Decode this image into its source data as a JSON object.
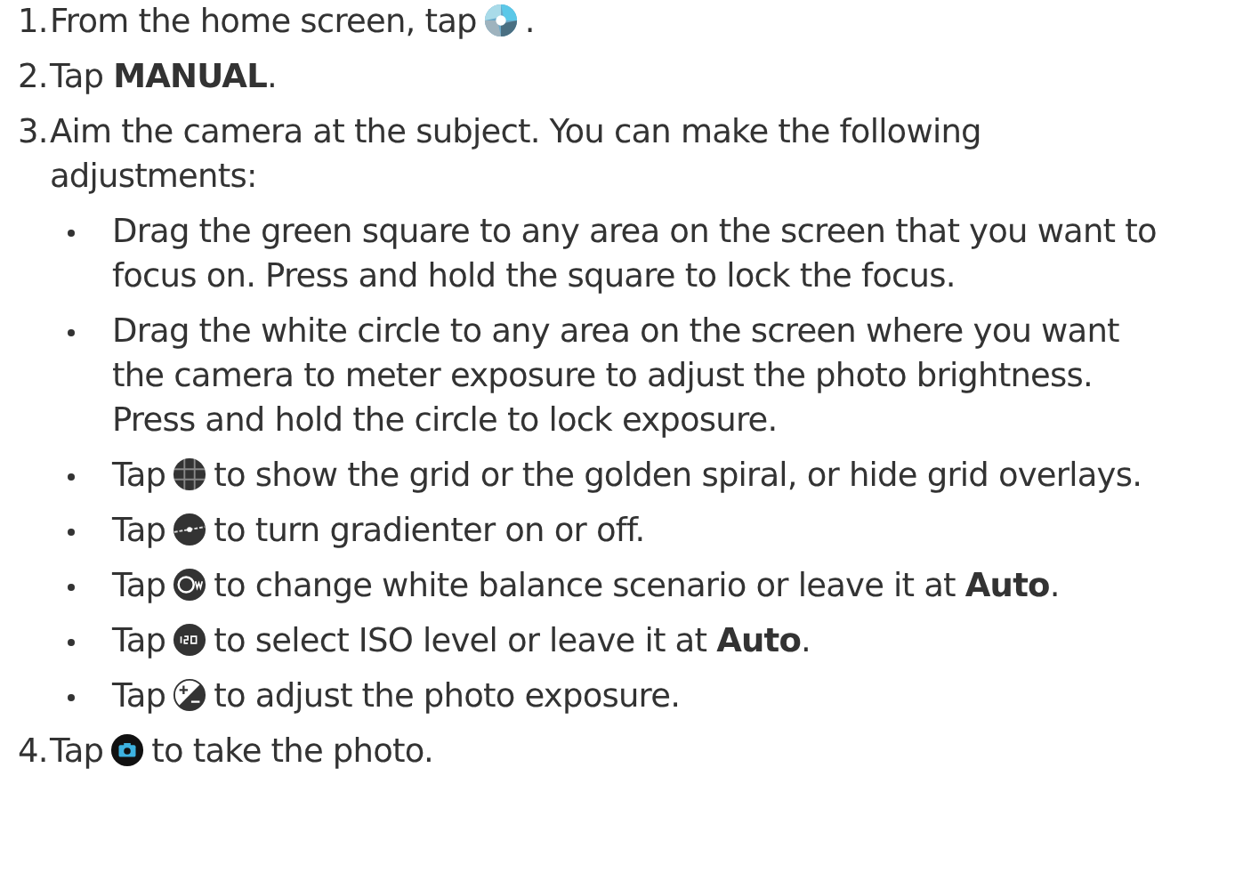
{
  "steps": [
    {
      "number": "1.",
      "parts": [
        {
          "kind": "text",
          "text": "From the home screen, tap"
        },
        {
          "kind": "app-icon"
        },
        {
          "kind": "text",
          "text": "."
        }
      ]
    },
    {
      "number": "2.",
      "parts": [
        {
          "kind": "text",
          "text": "Tap **MANUAL**."
        }
      ]
    },
    {
      "number": "3.",
      "parts": [
        {
          "kind": "text",
          "text": "Aim the camera at the subject. You can make the following adjustments:"
        }
      ],
      "bullets": [
        {
          "parts": [
            {
              "kind": "text",
              "text": "Drag the green square to any area on the screen that you want to focus on. Press and hold the square to lock the focus."
            }
          ]
        },
        {
          "parts": [
            {
              "kind": "text",
              "text": "Drag the white circle to any area on the screen where you want the camera to meter exposure to adjust the photo brightness. Press and hold the circle to lock exposure."
            }
          ]
        },
        {
          "parts": [
            {
              "kind": "text",
              "text": "Tap"
            },
            {
              "kind": "grid-icon"
            },
            {
              "kind": "text",
              "text": "to show the grid or the golden spiral, or hide grid overlays."
            }
          ]
        },
        {
          "parts": [
            {
              "kind": "text",
              "text": "Tap"
            },
            {
              "kind": "level-icon"
            },
            {
              "kind": "text",
              "text": "to turn gradienter on or off."
            }
          ]
        },
        {
          "parts": [
            {
              "kind": "text",
              "text": "Tap"
            },
            {
              "kind": "wb-icon"
            },
            {
              "kind": "text",
              "text": "to change white balance scenario or leave it at **Auto**."
            }
          ]
        },
        {
          "parts": [
            {
              "kind": "text",
              "text": "Tap"
            },
            {
              "kind": "iso-icon"
            },
            {
              "kind": "text",
              "text": "to select ISO level or leave it at **Auto**."
            }
          ]
        },
        {
          "parts": [
            {
              "kind": "text",
              "text": "Tap"
            },
            {
              "kind": "exposure-icon"
            },
            {
              "kind": "text",
              "text": "to adjust the photo exposure."
            }
          ]
        }
      ]
    },
    {
      "number": "4.",
      "parts": [
        {
          "kind": "text",
          "text": "Tap"
        },
        {
          "kind": "shutter-icon"
        },
        {
          "kind": "text",
          "text": "to take the photo."
        }
      ]
    }
  ]
}
